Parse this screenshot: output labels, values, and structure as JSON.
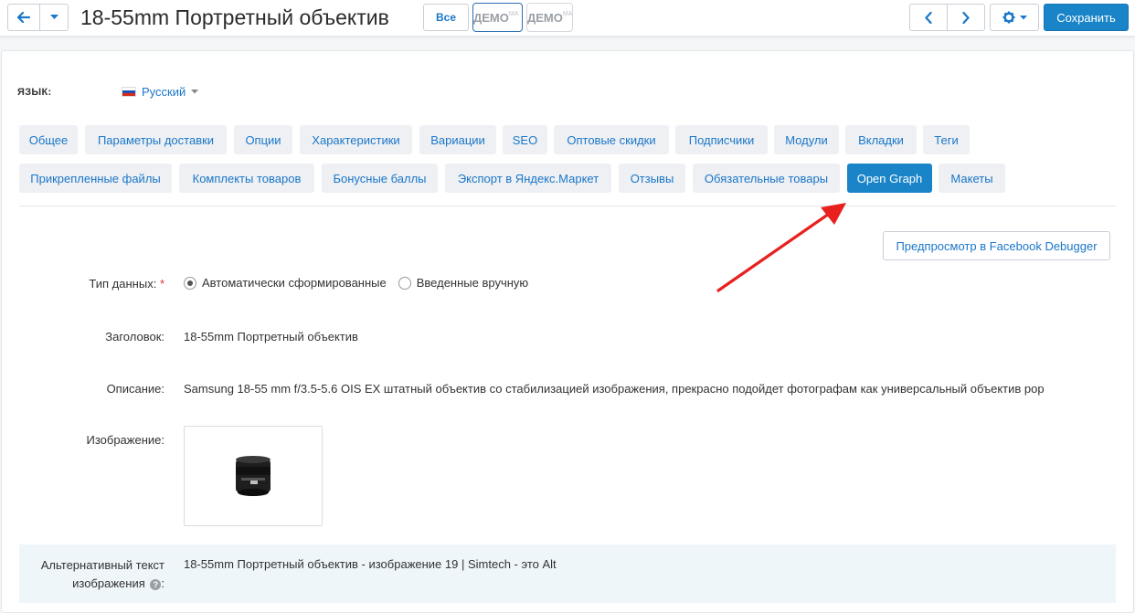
{
  "header": {
    "title": "18-55mm Портретный объектив",
    "all_label": "Все",
    "demo1": "ДЕМО",
    "demo1_sub": "MA",
    "demo2": "ДЕМО",
    "demo2_sub": "MA",
    "save_label": "Сохранить"
  },
  "language": {
    "label": "ЯЗЫК:",
    "value": "Русский"
  },
  "tabs_row1": [
    {
      "label": "Общее"
    },
    {
      "label": "Параметры доставки"
    },
    {
      "label": "Опции"
    },
    {
      "label": "Характеристики"
    },
    {
      "label": "Вариации"
    },
    {
      "label": "SEO"
    },
    {
      "label": "Оптовые скидки"
    },
    {
      "label": "Подписчики"
    },
    {
      "label": "Модули"
    },
    {
      "label": "Вкладки"
    },
    {
      "label": "Теги"
    }
  ],
  "tabs_row2": [
    {
      "label": "Прикрепленные файлы"
    },
    {
      "label": "Комплекты товаров"
    },
    {
      "label": "Бонусные баллы"
    },
    {
      "label": "Экспорт в Яндекс.Маркет"
    },
    {
      "label": "Отзывы"
    },
    {
      "label": "Обязательные товары"
    },
    {
      "label": "Open Graph",
      "active": true
    },
    {
      "label": "Макеты"
    }
  ],
  "fb_button": "Предпросмотр в Facebook Debugger",
  "form": {
    "data_type_label": "Тип данных:",
    "required_mark": "*",
    "radio_auto": "Автоматически сформированные",
    "radio_manual": "Введенные вручную",
    "title_label": "Заголовок:",
    "title_value": "18-55mm Портретный объектив",
    "description_label": "Описание:",
    "description_value": "Samsung 18-55 mm f/3.5-5.6 OIS EX штатный объектив со стабилизацией изображения, прекрасно подойдет фотографам как универсальный объектив pop",
    "image_label": "Изображение:",
    "alt_label_line1": "Альтернативный текст",
    "alt_label_line2": "изображения",
    "alt_value": "18-55mm Портретный объектив - изображение 19 | Simtech - это Alt"
  },
  "colors": {
    "accent": "#1a84c8",
    "link": "#1a77c9",
    "annotation_arrow": "#e8201e"
  }
}
